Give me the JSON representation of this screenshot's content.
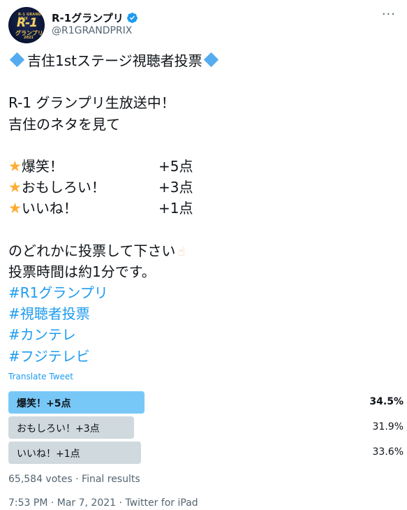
{
  "author": {
    "display_name": "R-1グランプリ",
    "handle": "@R1GRANDPRIX",
    "verified": true,
    "avatar_logo": {
      "top": "R-1 GRAND PRIX",
      "main": "R-1",
      "bottom": "グランプリ",
      "year": "2021"
    }
  },
  "tweet": {
    "title": "吉住1stステージ視聴者投票",
    "line1": "R-1 グランプリ生放送中！",
    "line2": "吉住のネタを見て",
    "scores": [
      {
        "label": "爆笑！",
        "points": "+5点"
      },
      {
        "label": "おもしろい！",
        "points": "+3点"
      },
      {
        "label": "いいね！",
        "points": "+1点"
      }
    ],
    "line3": "のどれかに投票して下さい",
    "line4": "投票時間は約1分です。",
    "hashtags": [
      "#R1グランプリ",
      "#視聴者投票",
      "#カンテレ",
      "#フジテレビ"
    ]
  },
  "translate_label": "Translate Tweet",
  "poll": {
    "options": [
      {
        "label": "爆笑！+5点",
        "percent_text": "34.5%",
        "percent": 34.5,
        "winner": true
      },
      {
        "label": "おもしろい！+3点",
        "percent_text": "31.9%",
        "percent": 31.9,
        "winner": false
      },
      {
        "label": "いいね！+1点",
        "percent_text": "33.6%",
        "percent": 33.6,
        "winner": false
      }
    ],
    "summary": "65,584 votes · Final results"
  },
  "timestamp": "7:53 PM · Mar 7, 2021 · Twitter for iPad",
  "colors": {
    "accent": "#1d9bf0",
    "winner_bar": "#78c8f7",
    "bar": "#cfd9de",
    "diamond": "#55acee",
    "star": "#ffac33"
  },
  "icons": {
    "title": "blue-diamond-icon",
    "score": "star-icon",
    "hand": "pointing-hand-icon",
    "more": "more-icon",
    "verified": "verified-badge-icon"
  }
}
